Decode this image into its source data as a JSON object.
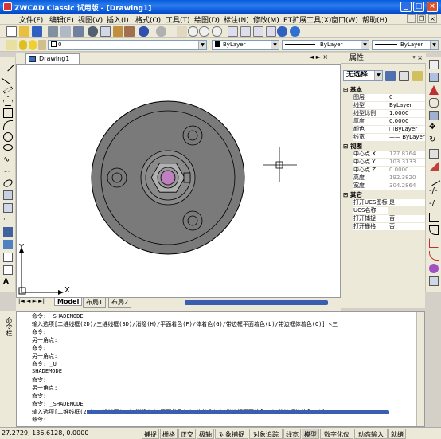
{
  "window": {
    "title": "ZWCAD Classic 试用版 - [Drawing1]",
    "min_label": "_",
    "max_label": "□",
    "close_label": "×"
  },
  "menu": [
    "文件(F)",
    "编辑(E)",
    "视图(V)",
    "插入(I)",
    "格式(O)",
    "工具(T)",
    "绘图(D)",
    "标注(N)",
    "修改(M)",
    "ET扩展工具(X)",
    "窗口(W)",
    "帮助(H)"
  ],
  "layer_toolbar": {
    "layer_value": "0",
    "color_value": "ByLayer",
    "linetype_value": "ByLayer",
    "lineweight_value": "ByLayer"
  },
  "drawing": {
    "tab_label": "Drawing1",
    "nav_arrows": "◄ ► ×",
    "layout_tabs": [
      "Model",
      "布局1",
      "布局2"
    ]
  },
  "ucs": {
    "x_label": "X",
    "y_label": "Y"
  },
  "properties": {
    "title": "属性",
    "header_controls": "ᵠ ×",
    "selection": "无选择",
    "sections": {
      "basic": "基本",
      "view": "视图",
      "other": "其它"
    },
    "basic_rows": [
      {
        "k": "图层",
        "v": "0"
      },
      {
        "k": "线型",
        "v": "ByLayer"
      },
      {
        "k": "线型比例",
        "v": "1.0000"
      },
      {
        "k": "厚度",
        "v": "0.0000"
      },
      {
        "k": "颜色",
        "v": "□ByLayer"
      },
      {
        "k": "线宽",
        "v": "—— ByLayer"
      }
    ],
    "view_rows": [
      {
        "k": "中心点 X",
        "v": "127.8764"
      },
      {
        "k": "中心点 Y",
        "v": "103.3133"
      },
      {
        "k": "中心点 Z",
        "v": "0.0000"
      },
      {
        "k": "高度",
        "v": "192.3820"
      },
      {
        "k": "宽度",
        "v": "304.2864"
      }
    ],
    "other_rows": [
      {
        "k": "打开UCS图标",
        "v": "是"
      },
      {
        "k": "UCS名称",
        "v": ""
      },
      {
        "k": "打开捕捉",
        "v": "否"
      },
      {
        "k": "打开栅格",
        "v": "否"
      }
    ]
  },
  "command": {
    "side_label": "命令栏",
    "lines": [
      "命令: _SHADEMODE",
      "输入选项[二维线框(2D)/三维线框(3D)/消隐(H)/平面着色(F)/体着色(G)/带边框平面着色(L)/带边框体着色(O)] <三",
      "命令:",
      "另一角点:",
      "命令:",
      "另一角点:",
      "命令: _U",
      "SHADEMODE",
      "命令:",
      "另一角点:",
      "命令:",
      "命令: _SHADEMODE",
      "输入选项[二维线框(2D)/三维线框(3D)/消隐(H)/平面着色(F)/体着色(G)/带边框平面着色(L)/带边框体着色(O)] <三",
      "命令:"
    ]
  },
  "status": {
    "coords": "27.2729, 136.6128, 0.0000",
    "buttons": [
      "捕捉",
      "栅格",
      "正交",
      "极轴",
      "对象捕捉",
      "对象追踪",
      "线宽",
      "模型",
      "数字化仪",
      "动态输入",
      "就绪"
    ]
  },
  "colors": {
    "part_fill": "#7a7a7a",
    "part_stroke": "#000000",
    "hex_nut": "#c0c0c0",
    "hub": "#a0a0a0",
    "bore": "#c080c0"
  }
}
